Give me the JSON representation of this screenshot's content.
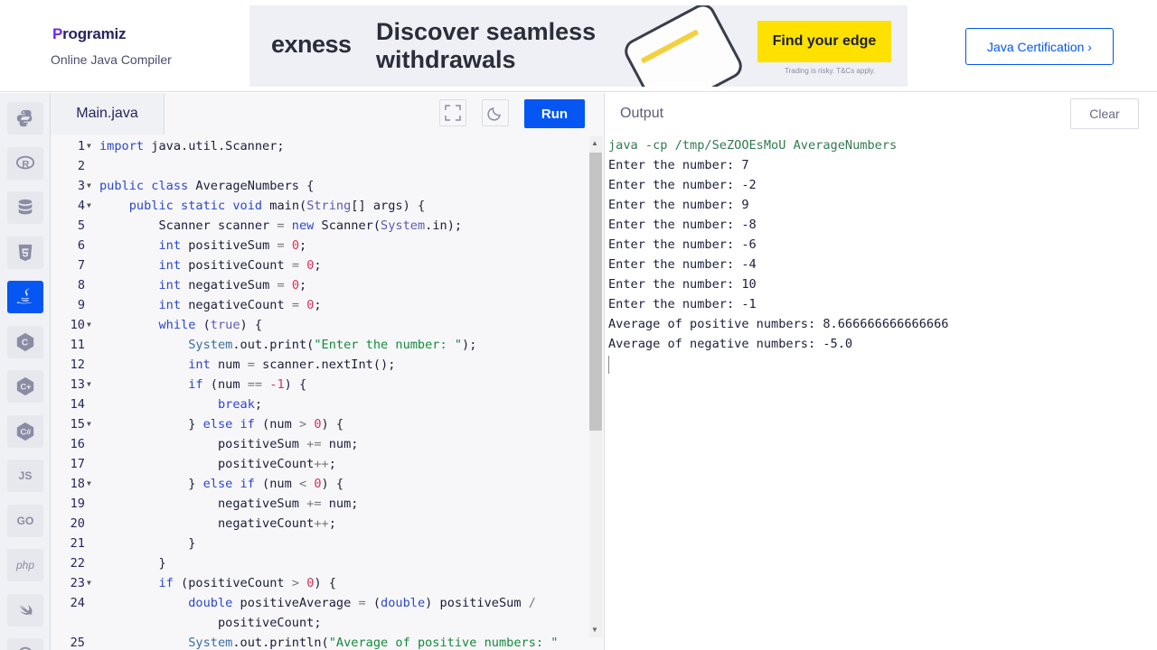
{
  "header": {
    "logo_text": "rogramiz",
    "logo_initial": "P",
    "subtitle": "Online Java Compiler",
    "ad": {
      "brand": "exness",
      "headline": "Discover seamless withdrawals",
      "cta": "Find your edge",
      "disclaimer": "Trading is risky. T&Cs apply."
    },
    "cert_button": "Java Certification ›"
  },
  "sidebar": {
    "languages": [
      {
        "name": "python",
        "label": ""
      },
      {
        "name": "r",
        "label": ""
      },
      {
        "name": "sql",
        "label": ""
      },
      {
        "name": "html",
        "label": ""
      },
      {
        "name": "java",
        "label": "",
        "active": true
      },
      {
        "name": "c",
        "label": ""
      },
      {
        "name": "cpp",
        "label": ""
      },
      {
        "name": "csharp",
        "label": ""
      },
      {
        "name": "js",
        "label": "JS"
      },
      {
        "name": "go",
        "label": "GO"
      },
      {
        "name": "php",
        "label": "php"
      },
      {
        "name": "swift",
        "label": ""
      },
      {
        "name": "rust",
        "label": ""
      }
    ]
  },
  "editor": {
    "tab_label": "Main.java",
    "run_label": "Run",
    "lines": [
      {
        "n": "1",
        "fold": true,
        "html": "<span class='kw'>import</span> java.util.Scanner;"
      },
      {
        "n": "2",
        "fold": false,
        "html": ""
      },
      {
        "n": "3",
        "fold": true,
        "html": "<span class='kw'>public class</span> AverageNumbers {"
      },
      {
        "n": "4",
        "fold": true,
        "html": "    <span class='kw'>public static void</span> main(<span class='ty'>String</span>[] args) {"
      },
      {
        "n": "5",
        "fold": false,
        "html": "        Scanner scanner <span class='op'>=</span> <span class='kw'>new</span> Scanner(<span class='ty'>System</span>.in);"
      },
      {
        "n": "6",
        "fold": false,
        "html": "        <span class='kw'>int</span> positiveSum <span class='op'>=</span> <span class='num'>0</span>;"
      },
      {
        "n": "7",
        "fold": false,
        "html": "        <span class='kw'>int</span> positiveCount <span class='op'>=</span> <span class='num'>0</span>;"
      },
      {
        "n": "8",
        "fold": false,
        "html": "        <span class='kw'>int</span> negativeSum <span class='op'>=</span> <span class='num'>0</span>;"
      },
      {
        "n": "9",
        "fold": false,
        "html": "        <span class='kw'>int</span> negativeCount <span class='op'>=</span> <span class='num'>0</span>;"
      },
      {
        "n": "10",
        "fold": true,
        "html": "        <span class='kw'>while</span> (<span class='ty'>true</span>) {"
      },
      {
        "n": "11",
        "fold": false,
        "html": "            <span class='cls'>System</span>.out.print(<span class='str'>\"Enter the number: \"</span>);"
      },
      {
        "n": "12",
        "fold": false,
        "html": "            <span class='kw'>int</span> num <span class='op'>=</span> scanner.nextInt();"
      },
      {
        "n": "13",
        "fold": true,
        "html": "            <span class='kw'>if</span> (num <span class='op'>==</span> <span class='num'>-1</span>) {"
      },
      {
        "n": "14",
        "fold": false,
        "html": "                <span class='kw'>break</span>;"
      },
      {
        "n": "15",
        "fold": true,
        "html": "            } <span class='kw'>else if</span> (num <span class='op'>&gt;</span> <span class='num'>0</span>) {"
      },
      {
        "n": "16",
        "fold": false,
        "html": "                positiveSum <span class='op'>+=</span> num;"
      },
      {
        "n": "17",
        "fold": false,
        "html": "                positiveCount<span class='op'>++</span>;"
      },
      {
        "n": "18",
        "fold": true,
        "html": "            } <span class='kw'>else if</span> (num <span class='op'>&lt;</span> <span class='num'>0</span>) {"
      },
      {
        "n": "19",
        "fold": false,
        "html": "                negativeSum <span class='op'>+=</span> num;"
      },
      {
        "n": "20",
        "fold": false,
        "html": "                negativeCount<span class='op'>++</span>;"
      },
      {
        "n": "21",
        "fold": false,
        "html": "            }"
      },
      {
        "n": "22",
        "fold": false,
        "html": "        }"
      },
      {
        "n": "23",
        "fold": true,
        "html": "        <span class='kw'>if</span> (positiveCount <span class='op'>&gt;</span> <span class='num'>0</span>) {"
      },
      {
        "n": "24",
        "fold": false,
        "html": "            <span class='kw'>double</span> positiveAverage <span class='op'>=</span> (<span class='kw'>double</span>) positiveSum <span class='op'>/</span>"
      },
      {
        "n": "",
        "fold": false,
        "html": "                positiveCount;"
      },
      {
        "n": "25",
        "fold": false,
        "html": "            <span class='cls'>System</span>.out.println(<span class='str'>\"Average of positive numbers: \"</span>"
      }
    ]
  },
  "output": {
    "title": "Output",
    "clear_label": "Clear",
    "command": "java -cp /tmp/SeZOOEsMoU AverageNumbers",
    "lines": [
      "Enter the number: 7",
      "Enter the number: -2",
      "Enter the number: 9",
      "Enter the number: -8",
      "Enter the number: -6",
      "Enter the number: -4",
      "Enter the number: 10",
      "Enter the number: -1",
      "Average of positive numbers: 8.666666666666666",
      "Average of negative numbers: -5.0"
    ]
  },
  "colors": {
    "accent": "#0556f3",
    "sidebar_bg": "#f0f1f5",
    "editor_bg": "#f7f7f9"
  }
}
